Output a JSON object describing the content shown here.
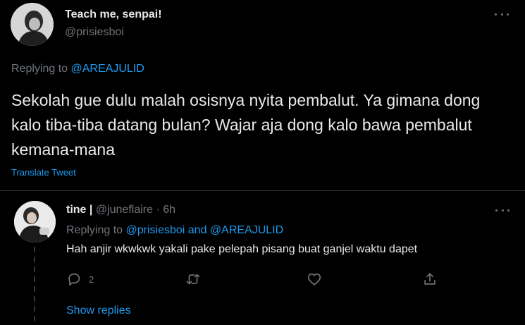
{
  "main_tweet": {
    "display_name": "Teach me, senpai!",
    "handle": "@prisiesboi",
    "replying_prefix": "Replying to",
    "replying_to": "@AREAJULID",
    "text": "Sekolah gue dulu malah osisnya nyita pembalut. Ya gimana dong kalo tiba-tiba datang bulan? Wajar aja dong kalo bawa pembalut kemana-mana",
    "translate_label": "Translate Tweet",
    "more_icon": "more-horizontal-icon"
  },
  "reply": {
    "display_name": "tine |",
    "handle": "@juneflaire",
    "separator": "·",
    "time": "6h",
    "replying_prefix": "Replying to",
    "replying_to_1": "@prisiesboi",
    "replying_and": "and",
    "replying_to_2": "@AREAJULID",
    "text": "Hah anjir wkwkwk yakali pake pelepah pisang buat ganjel waktu dapet",
    "more_icon": "more-horizontal-icon",
    "actions": {
      "reply_count": "2",
      "reply_icon": "reply-icon",
      "retweet_icon": "retweet-icon",
      "like_icon": "heart-icon",
      "share_icon": "share-icon"
    }
  },
  "show_replies_label": "Show replies",
  "colors": {
    "background": "#000000",
    "text_primary": "#e7e9ea",
    "text_secondary": "#71767b",
    "link": "#1d9bf0",
    "divider": "#2f3336"
  }
}
